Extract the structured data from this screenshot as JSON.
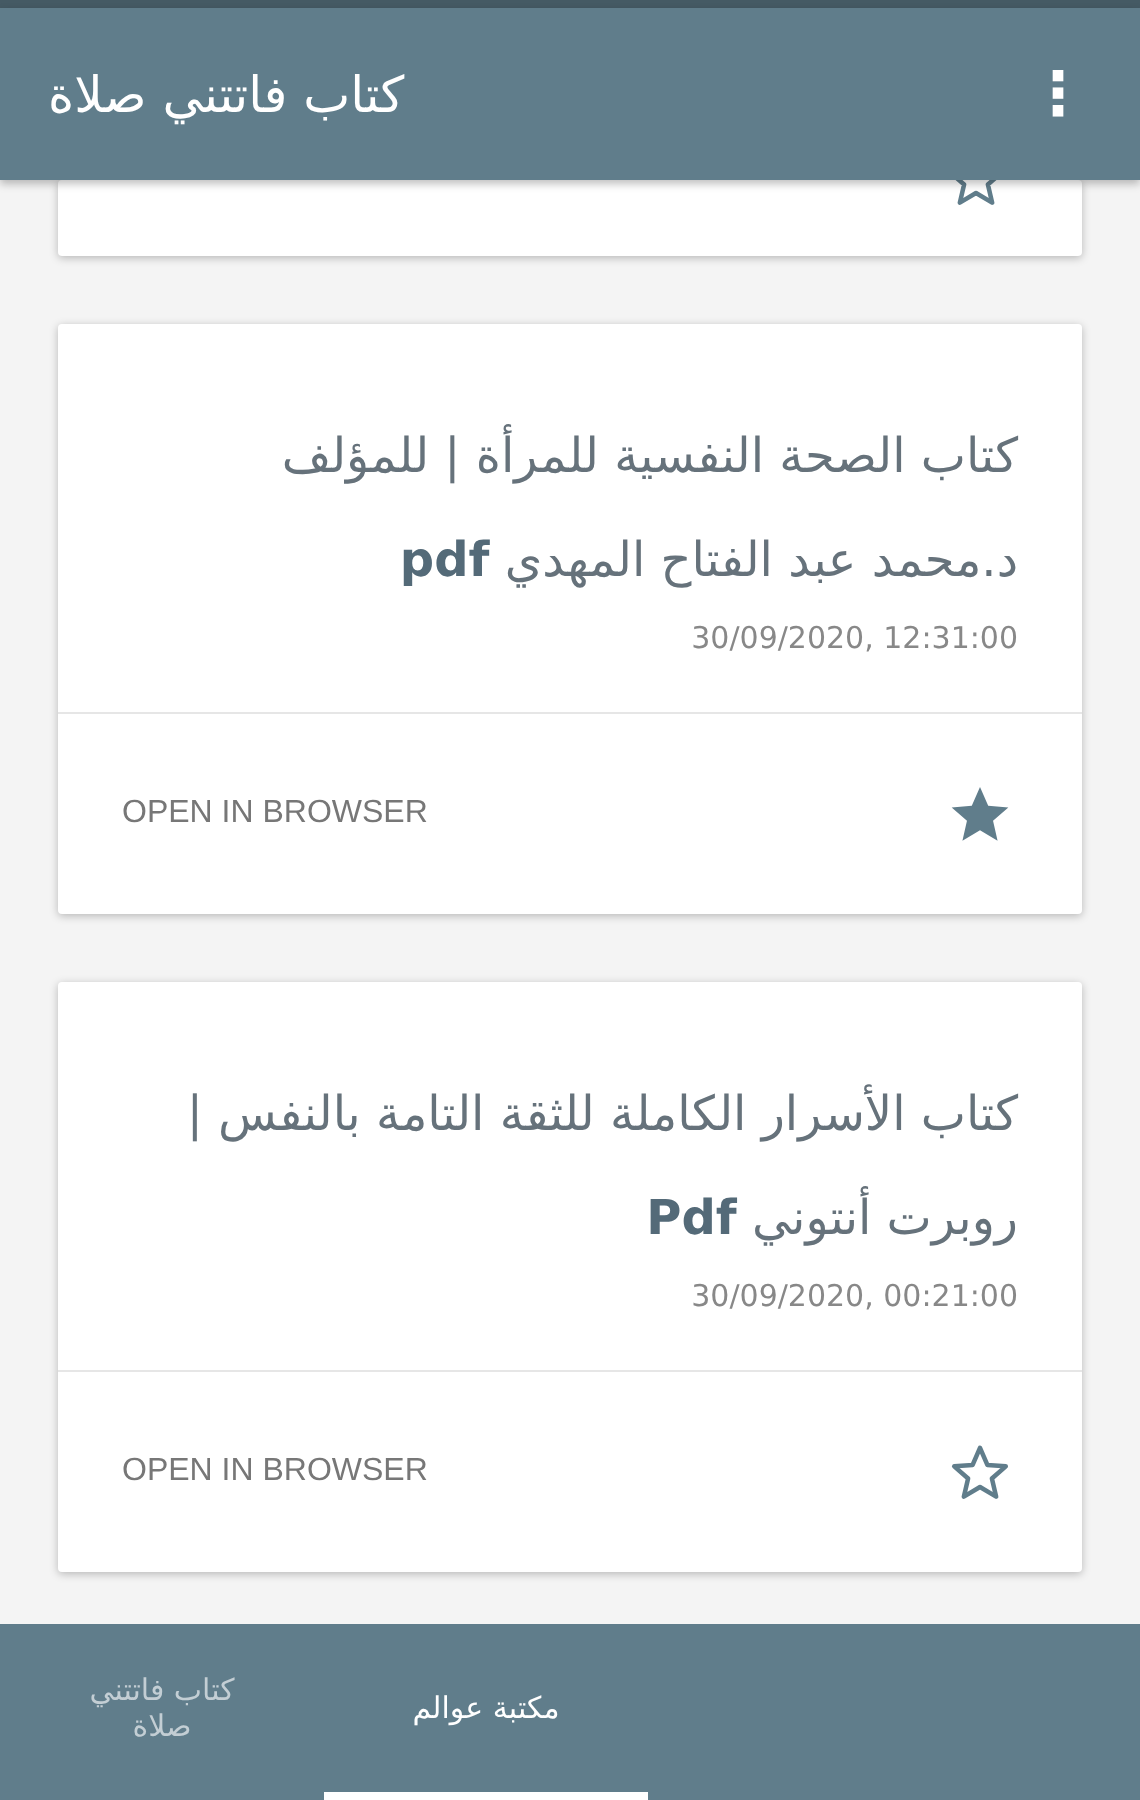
{
  "app_bar": {
    "title": "كتاب فاتتني صلاة",
    "menu_icon": "⋮"
  },
  "partial_card": {
    "starred": false
  },
  "cards": [
    {
      "title": "كتاب الصحة النفسية للمرأة | للمؤلف د.محمد عبد الفتاح المهدي **pdf**",
      "date": "30/09/2020, 12:31:00",
      "action": "OPEN IN BROWSER",
      "starred": true
    },
    {
      "title": "كتاب الأسرار الكاملة للثقة التامة بالنفس | روبرت أنتوني **Pdf**",
      "date": "30/09/2020, 00:21:00",
      "action": "OPEN IN BROWSER",
      "starred": false
    }
  ],
  "bottom_tabs": [
    {
      "label": "مكتبة عوالم",
      "selected": true
    },
    {
      "label": "كتاب فاتتني صلاة",
      "selected": false
    }
  ]
}
